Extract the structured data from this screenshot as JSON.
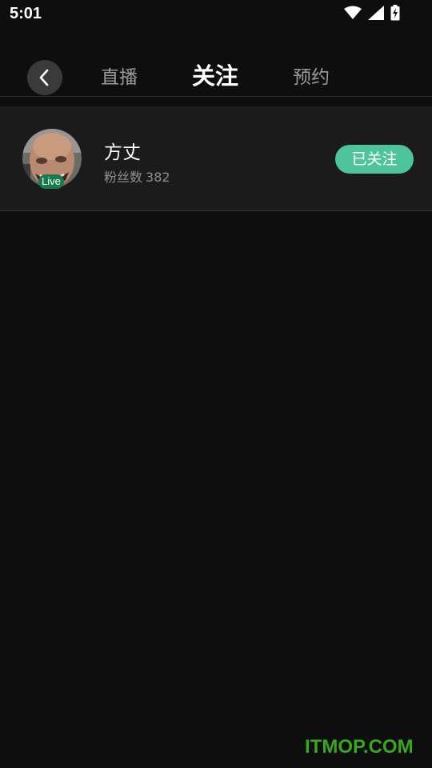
{
  "status_bar": {
    "time": "5:01",
    "icons": [
      "wifi-icon",
      "cellular-signal-icon",
      "battery-charging-icon"
    ]
  },
  "nav": {
    "back_icon": "chevron-left-icon",
    "tabs": [
      {
        "label": "直播",
        "selected": false
      },
      {
        "label": "关注",
        "selected": true
      },
      {
        "label": "预约",
        "selected": false
      }
    ]
  },
  "follow_list": [
    {
      "name": "方丈",
      "fans_label": "粉丝数",
      "fans_count": "382",
      "live_badge": "Live",
      "button_label": "已关注"
    }
  ],
  "watermark": "ITMOP.COM",
  "colors": {
    "background": "#0e0e0e",
    "item_background": "#1b1b1b",
    "accent_green": "#4fc39a",
    "live_badge": "#1a7a4e"
  }
}
